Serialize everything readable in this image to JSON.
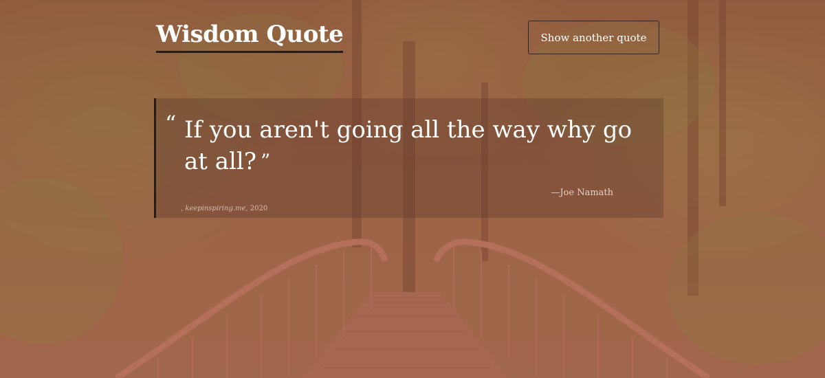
{
  "header": {
    "title": "Wisdom Quote"
  },
  "actions": {
    "show_another": "Show another quote"
  },
  "quote": {
    "open_mark": "“",
    "text": "If you aren't going all the way why go at all?",
    "close_mark": "”",
    "author": "—Joe Namath",
    "source_site": "keepinspiring.me",
    "source_year": "2020"
  },
  "colors": {
    "tint": "#a25f46",
    "text": "#ffffff",
    "border": "#2a1a12"
  }
}
